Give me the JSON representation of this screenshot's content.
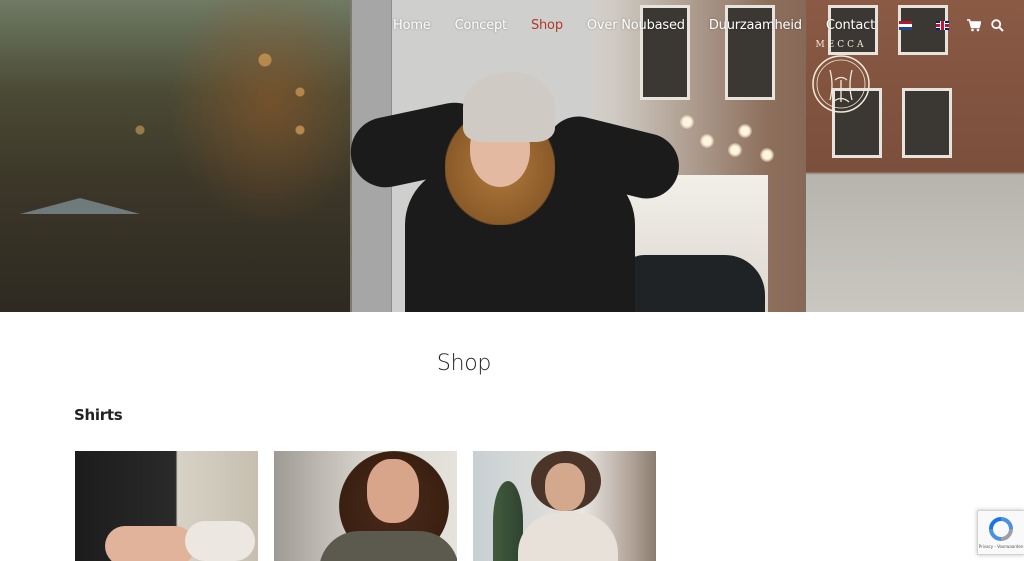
{
  "nav": {
    "items": [
      {
        "label": "Home",
        "active": false
      },
      {
        "label": "Concept",
        "active": false
      },
      {
        "label": "Shop",
        "active": true
      },
      {
        "label": "Over Noubased",
        "active": false
      },
      {
        "label": "Duurzaamheid",
        "active": false
      },
      {
        "label": "Contact",
        "active": false
      }
    ],
    "languages": [
      "nl-flag-icon",
      "en-flag-icon"
    ],
    "icons": [
      "cart-icon",
      "search-icon"
    ],
    "active_color": "#b13a2a"
  },
  "logo": {
    "text": "MECCA"
  },
  "page": {
    "title": "Shop",
    "section_title": "Shirts"
  },
  "products": [
    "product-image-1",
    "product-image-2",
    "product-image-3"
  ],
  "recaptcha": {
    "text": "Privacy - Voorwaarden"
  }
}
